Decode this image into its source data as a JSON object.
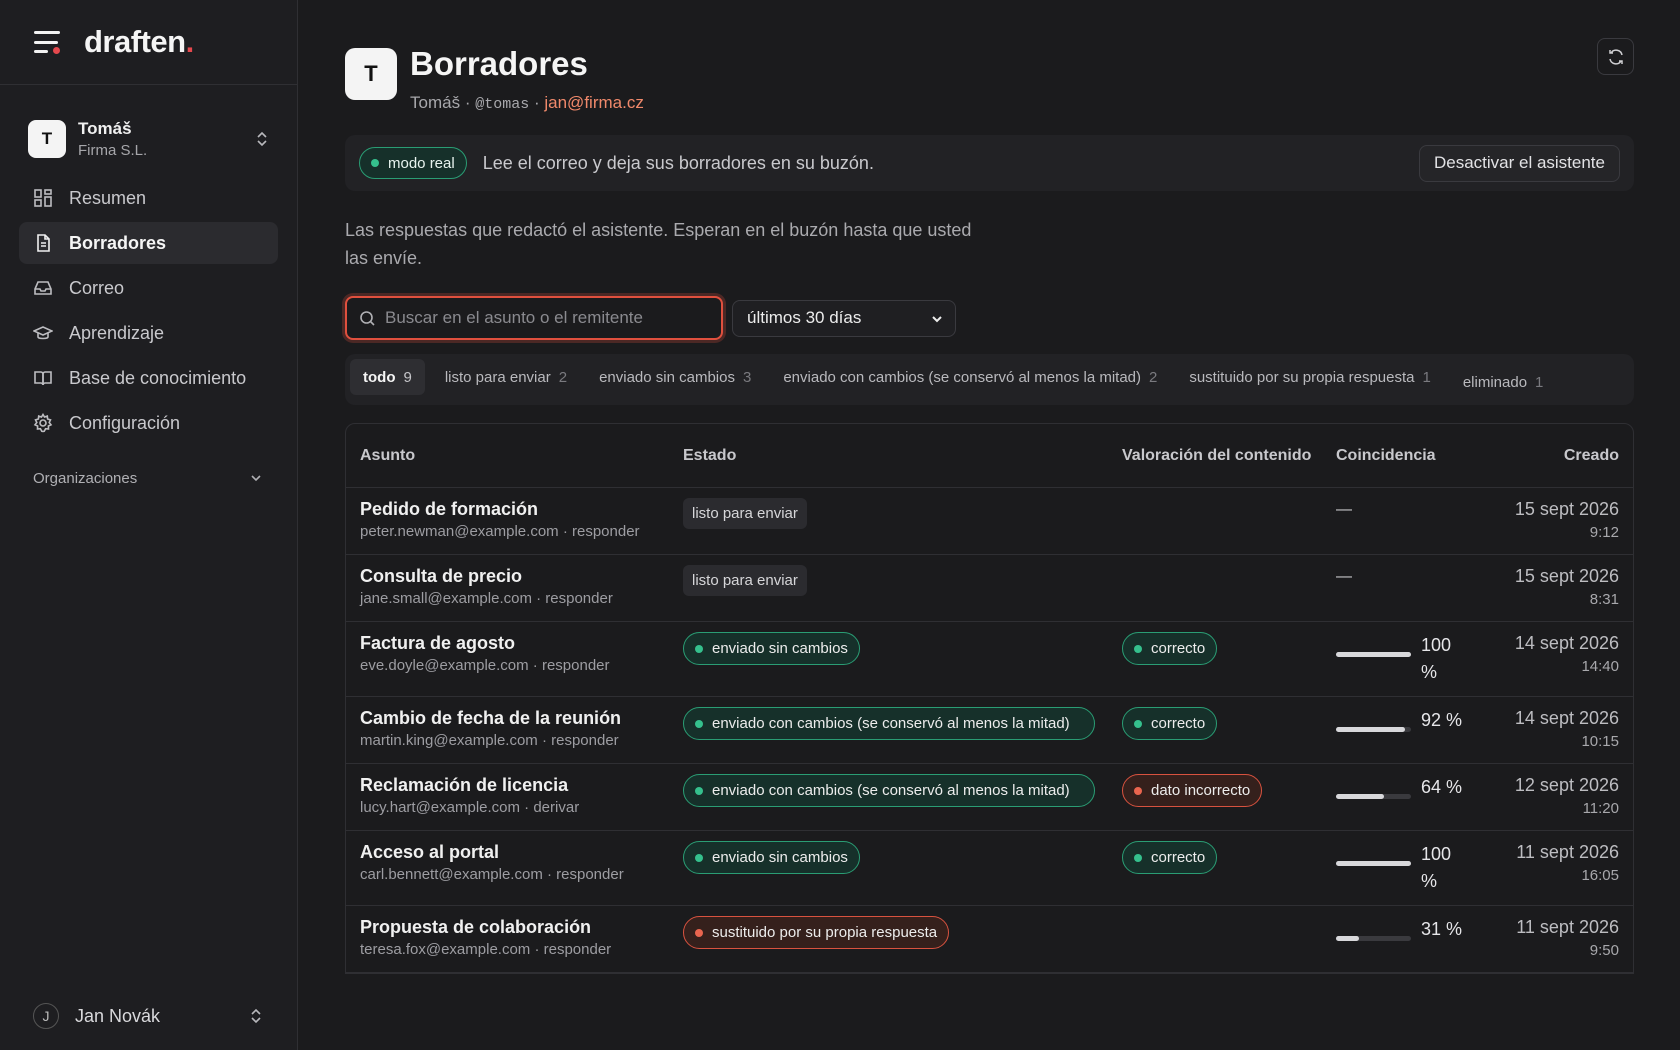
{
  "app": {
    "brand": "draften",
    "brand_dot": "."
  },
  "sidebar": {
    "org": {
      "initial": "T",
      "name": "Tomáš",
      "company": "Firma S.L."
    },
    "items": [
      {
        "label": "Resumen",
        "icon": "grid-icon"
      },
      {
        "label": "Borradores",
        "icon": "document-icon",
        "active": true
      },
      {
        "label": "Correo",
        "icon": "inbox-icon"
      },
      {
        "label": "Aprendizaje",
        "icon": "graduation-cap-icon"
      },
      {
        "label": "Base de conocimiento",
        "icon": "book-icon"
      },
      {
        "label": "Configuración",
        "icon": "gear-icon"
      }
    ],
    "orgs_label": "Organizaciones",
    "user": {
      "initial": "J",
      "name": "Jan Novák"
    }
  },
  "header": {
    "initial": "T",
    "title": "Borradores",
    "name": "Tomáš",
    "sep": "·",
    "handle": "@tomas",
    "email": "jan@firma.cz"
  },
  "banner": {
    "mode": "modo real",
    "text": "Lee el correo y deja sus borradores en su buzón.",
    "button": "Desactivar el asistente"
  },
  "description": "Las respuestas que redactó el asistente. Esperan en el buzón hasta que usted las envíe.",
  "filters": {
    "search_placeholder": "Buscar en el asunto o el remitente",
    "search_value": "",
    "period": "últimos 30 días"
  },
  "tabs": [
    {
      "label": "todo",
      "count": "9",
      "active": true
    },
    {
      "label": "listo para enviar",
      "count": "2"
    },
    {
      "label": "enviado sin cambios",
      "count": "3"
    },
    {
      "label": "enviado con cambios (se conservó al menos la mitad)",
      "count": "2"
    },
    {
      "label": "sustituido por su propia respuesta",
      "count": "1"
    },
    {
      "label": "eliminado",
      "count": "1"
    }
  ],
  "table": {
    "headers": [
      "Asunto",
      "Estado",
      "Valoración del contenido",
      "Coincidencia",
      "Creado"
    ],
    "rows": [
      {
        "subject": "Pedido de formación",
        "meta": "peter.newman@example.com · responder",
        "status": "listo para enviar",
        "status_kind": "plain",
        "rating": "",
        "rating_kind": "",
        "match": "—",
        "match_value": null,
        "date": "15 sept 2026",
        "time": "9:12"
      },
      {
        "subject": "Consulta de precio",
        "meta": "jane.small@example.com · responder",
        "status": "listo para enviar",
        "status_kind": "plain",
        "rating": "",
        "rating_kind": "",
        "match": "—",
        "match_value": null,
        "date": "15 sept 2026",
        "time": "8:31"
      },
      {
        "subject": "Factura de agosto",
        "meta": "eve.doyle@example.com · responder",
        "status": "enviado sin cambios",
        "status_kind": "green",
        "rating": "correcto",
        "rating_kind": "green",
        "match": "100 %",
        "match_value": 100,
        "date": "14 sept 2026",
        "time": "14:40"
      },
      {
        "subject": "Cambio de fecha de la reunión",
        "meta": "martin.king@example.com · responder",
        "status": "enviado con cambios (se conservó al menos la mitad)",
        "status_kind": "green-wide",
        "rating": "correcto",
        "rating_kind": "green",
        "match": "92 %",
        "match_value": 92,
        "date": "14 sept 2026",
        "time": "10:15"
      },
      {
        "subject": "Reclamación de licencia",
        "meta": "lucy.hart@example.com · derivar",
        "status": "enviado con cambios (se conservó al menos la mitad)",
        "status_kind": "green-wide",
        "rating": "dato incorrecto",
        "rating_kind": "red",
        "match": "64 %",
        "match_value": 64,
        "date": "12 sept 2026",
        "time": "11:20"
      },
      {
        "subject": "Acceso al portal",
        "meta": "carl.bennett@example.com · responder",
        "status": "enviado sin cambios",
        "status_kind": "green",
        "rating": "correcto",
        "rating_kind": "green",
        "match": "100 %",
        "match_value": 100,
        "date": "11 sept 2026",
        "time": "16:05"
      },
      {
        "subject": "Propuesta de colaboración",
        "meta": "teresa.fox@example.com · responder",
        "status": "sustituido por su propia respuesta",
        "status_kind": "red",
        "rating": "",
        "rating_kind": "",
        "match": "31 %",
        "match_value": 31,
        "date": "11 sept 2026",
        "time": "9:50"
      }
    ]
  }
}
